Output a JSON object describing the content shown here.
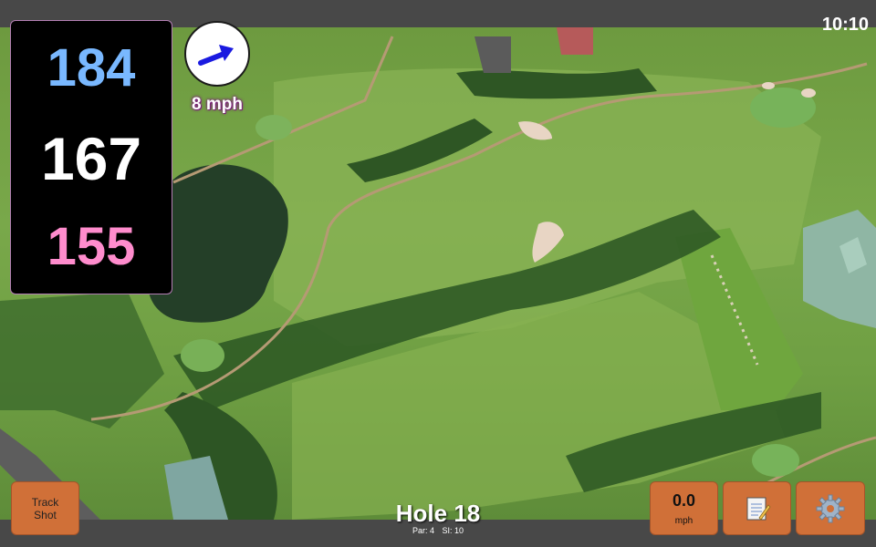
{
  "status": {
    "time": "10:10"
  },
  "distances": {
    "back": "184",
    "middle": "167",
    "front": "155"
  },
  "wind": {
    "speed": "8 mph",
    "icon": "wind-arrow-icon"
  },
  "hole": {
    "title": "Hole 18",
    "par": "Par: 4",
    "stroke_index": "SI: 10"
  },
  "buttons": {
    "track_shot": [
      "Track",
      "Shot"
    ],
    "speed": {
      "value": "0.0",
      "unit": "mph"
    },
    "notes_icon": "notepad-icon",
    "settings_icon": "gear-icon"
  },
  "colors": {
    "back_distance": "#79b8ff",
    "middle_distance": "#ffffff",
    "front_distance": "#ff8ccd",
    "button": "#d07038"
  }
}
